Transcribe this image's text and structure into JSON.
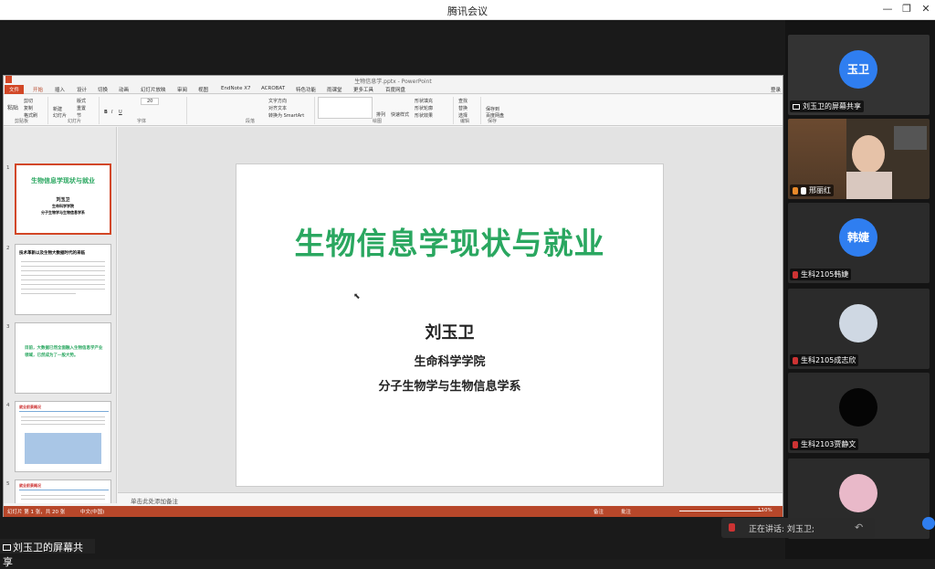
{
  "window": {
    "title": "腾讯会议",
    "minimize": "—",
    "restore": "❐",
    "close": "✕"
  },
  "ppt": {
    "doc_title": "生物信息学.pptx - PowerPoint",
    "tabs": [
      "文件",
      "开始",
      "插入",
      "设计",
      "切换",
      "动画",
      "幻灯片放映",
      "审阅",
      "视图",
      "EndNote X7",
      "ACROBAT",
      "特色功能",
      "雨课堂",
      "更多工具",
      "百度网盘"
    ],
    "login": "登录",
    "ribbon": {
      "paste": "粘贴",
      "cut": "剪切",
      "copy": "复制",
      "format_painter": "格式刷",
      "new_slide": "新建\n幻灯片",
      "layout": "版式",
      "reset": "重置",
      "section": "节",
      "groups": [
        "剪贴板",
        "幻灯片",
        "字体",
        "段落",
        "绘图",
        "编辑",
        "保存"
      ],
      "text_direction": "文字方向",
      "align_text": "对齐文本",
      "smartart": "转换为 SmartArt",
      "arrange": "排列",
      "quick_styles": "快速样式",
      "shape_fill": "形状填充",
      "shape_outline": "形状轮廓",
      "shape_effects": "形状效果",
      "find": "查找",
      "replace": "替换",
      "select": "选择",
      "save_baidu": "保存到\n百度网盘",
      "font_size": "20"
    },
    "thumbnails": [
      {
        "num": "1",
        "title": "生物信息学现状与就业",
        "author": "刘玉卫",
        "sub1": "生命科学学院",
        "sub2": "分子生物学与生物信息学系"
      },
      {
        "num": "2",
        "title": "技术革新以及生物大数据时代的来临"
      },
      {
        "num": "3",
        "title": "目前，大数据已然全面融入生物信息学产业领域，已然成为了一股大势。"
      },
      {
        "num": "4",
        "title": "就业前景概况"
      },
      {
        "num": "5",
        "title": "就业前景概况"
      }
    ],
    "slide": {
      "title": "生物信息学现状与就业",
      "author": "刘玉卫",
      "dept": "生命科学学院",
      "lab": "分子生物学与生物信息学系"
    },
    "notes_placeholder": "单击此处添加备注",
    "status": {
      "slide_count": "幻灯片 第 1 张，共 20 张",
      "language": "中文(中国)",
      "notes": "备注",
      "comments": "批注",
      "zoom": "110%"
    }
  },
  "share_label": "刘玉卫的屏幕共享",
  "participants": [
    {
      "name": "刘玉卫的屏幕共享",
      "avatar": "玉卫",
      "color": "#2f7ef0",
      "type": "avatar",
      "mic": "share"
    },
    {
      "name": "邢丽红",
      "type": "video",
      "mic": "on"
    },
    {
      "name": "生科2105韩婕",
      "avatar": "韩婕",
      "color": "#2f7ef0",
      "type": "avatar",
      "mic": "off"
    },
    {
      "name": "生科2105成志欣",
      "type": "photo",
      "mic": "off"
    },
    {
      "name": "生科2103贾静文",
      "type": "photo-dark",
      "mic": "off"
    },
    {
      "name": "",
      "type": "photo-anime",
      "mic": "off"
    }
  ],
  "speaking": {
    "label": "正在讲话: 刘玉卫;"
  }
}
